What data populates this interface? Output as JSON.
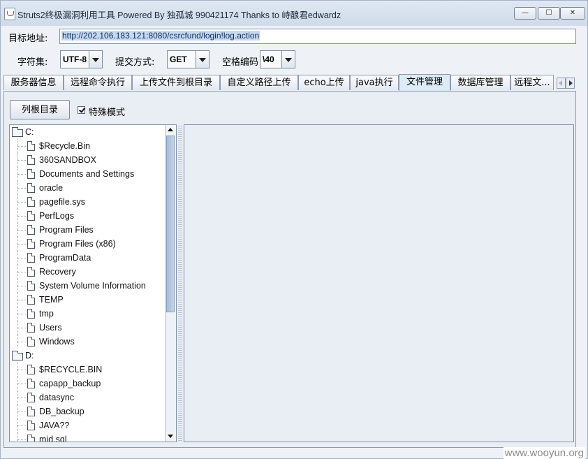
{
  "window": {
    "title": "Struts2终极漏洞利用工具   Powered By 独孤城 990421174 Thanks to 峙酿君edwardz",
    "minimize": "—",
    "maximize": "☐",
    "close": "✕"
  },
  "form": {
    "target_label": "目标地址:",
    "target_url": "http://202.106.183.121:8080/csrcfund/login!log.action",
    "charset_label": "字符集:",
    "charset_value": "UTF-8",
    "method_label": "提交方式:",
    "method_value": "GET",
    "space_label": "空格编码",
    "space_value": "\\40"
  },
  "tabs": [
    {
      "label": "服务器信息"
    },
    {
      "label": "远程命令执行"
    },
    {
      "label": "上传文件到根目录"
    },
    {
      "label": "自定义路径上传"
    },
    {
      "label": "echo上传"
    },
    {
      "label": "java执行"
    },
    {
      "label": "文件管理"
    },
    {
      "label": "数据库管理"
    },
    {
      "label": "远程文..."
    }
  ],
  "file_manager": {
    "list_button": "列根目录",
    "special_mode_label": "特殊模式",
    "special_mode_checked": true
  },
  "tree": [
    {
      "label": "C:",
      "type": "folder",
      "depth": 0
    },
    {
      "label": "$Recycle.Bin",
      "type": "file",
      "depth": 1
    },
    {
      "label": "360SANDBOX",
      "type": "file",
      "depth": 1
    },
    {
      "label": "Documents and Settings",
      "type": "file",
      "depth": 1
    },
    {
      "label": "oracle",
      "type": "file",
      "depth": 1
    },
    {
      "label": "pagefile.sys",
      "type": "file",
      "depth": 1
    },
    {
      "label": "PerfLogs",
      "type": "file",
      "depth": 1
    },
    {
      "label": "Program Files",
      "type": "file",
      "depth": 1
    },
    {
      "label": "Program Files (x86)",
      "type": "file",
      "depth": 1
    },
    {
      "label": "ProgramData",
      "type": "file",
      "depth": 1
    },
    {
      "label": "Recovery",
      "type": "file",
      "depth": 1
    },
    {
      "label": "System Volume Information",
      "type": "file",
      "depth": 1
    },
    {
      "label": "TEMP",
      "type": "file",
      "depth": 1
    },
    {
      "label": "tmp",
      "type": "file",
      "depth": 1
    },
    {
      "label": "Users",
      "type": "file",
      "depth": 1
    },
    {
      "label": "Windows",
      "type": "file",
      "depth": 1
    },
    {
      "label": "D:",
      "type": "folder",
      "depth": 0
    },
    {
      "label": "$RECYCLE.BIN",
      "type": "file",
      "depth": 1
    },
    {
      "label": "capapp_backup",
      "type": "file",
      "depth": 1
    },
    {
      "label": "datasync",
      "type": "file",
      "depth": 1
    },
    {
      "label": "DB_backup",
      "type": "file",
      "depth": 1
    },
    {
      "label": "JAVA??",
      "type": "file",
      "depth": 1
    },
    {
      "label": "mid.sql",
      "type": "file",
      "depth": 1
    }
  ],
  "watermark": "www.wooyun.org"
}
